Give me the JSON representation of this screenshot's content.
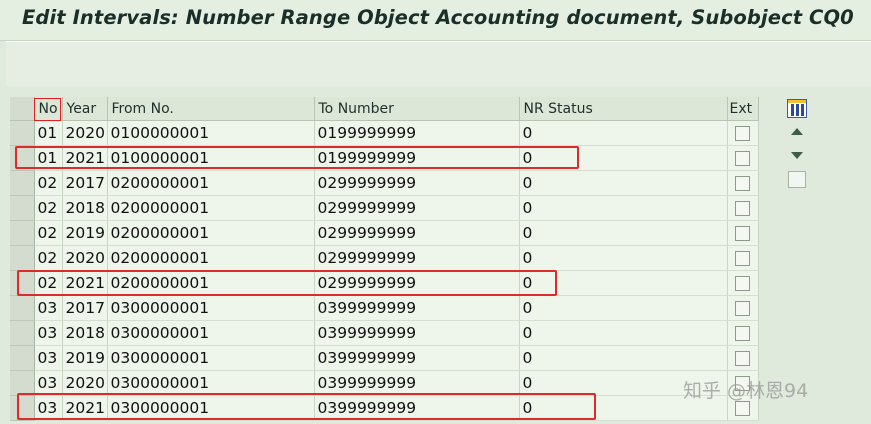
{
  "window": {
    "title": "Edit Intervals: Number Range Object Accounting document, Subobject CQ0"
  },
  "table": {
    "columns": {
      "no": "No",
      "year": "Year",
      "from": "From No.",
      "to": "To Number",
      "status": "NR Status",
      "ext": "Ext"
    },
    "rows": [
      {
        "no": "01",
        "year": "2020",
        "from": "0100000001",
        "to": "0199999999",
        "status": "0"
      },
      {
        "no": "01",
        "year": "2021",
        "from": "0100000001",
        "to": "0199999999",
        "status": "0"
      },
      {
        "no": "02",
        "year": "2017",
        "from": "0200000001",
        "to": "0299999999",
        "status": "0"
      },
      {
        "no": "02",
        "year": "2018",
        "from": "0200000001",
        "to": "0299999999",
        "status": "0"
      },
      {
        "no": "02",
        "year": "2019",
        "from": "0200000001",
        "to": "0299999999",
        "status": "0"
      },
      {
        "no": "02",
        "year": "2020",
        "from": "0200000001",
        "to": "0299999999",
        "status": "0"
      },
      {
        "no": "02",
        "year": "2021",
        "from": "0200000001",
        "to": "0299999999",
        "status": "0"
      },
      {
        "no": "03",
        "year": "2017",
        "from": "0300000001",
        "to": "0399999999",
        "status": "0"
      },
      {
        "no": "03",
        "year": "2018",
        "from": "0300000001",
        "to": "0399999999",
        "status": "0"
      },
      {
        "no": "03",
        "year": "2019",
        "from": "0300000001",
        "to": "0399999999",
        "status": "0"
      },
      {
        "no": "03",
        "year": "2020",
        "from": "0300000001",
        "to": "0399999999",
        "status": "0"
      },
      {
        "no": "03",
        "year": "2021",
        "from": "0300000001",
        "to": "0399999999",
        "status": "0"
      }
    ]
  },
  "tools": {
    "column_settings_icon": "column-config-icon",
    "scroll_up_icon": "arrow-up-icon",
    "scroll_down_icon": "arrow-down-icon"
  },
  "watermark": "知乎 @林恩94",
  "colors": {
    "highlight": "#dd2a2a",
    "background": "#dfeadc"
  }
}
